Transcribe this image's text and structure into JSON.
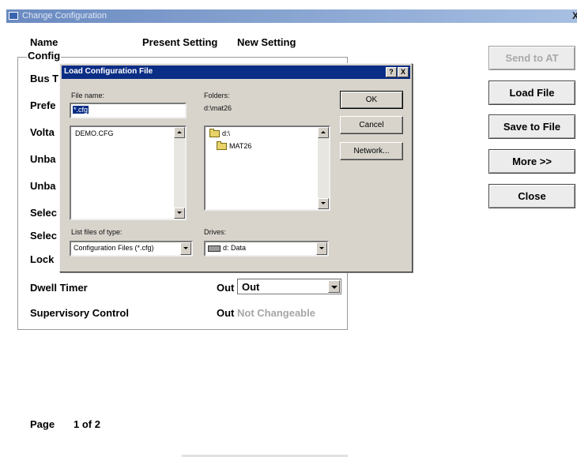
{
  "window": {
    "title": "Change Configuration",
    "close_glyph": "X"
  },
  "headers": {
    "name": "Name",
    "present": "Present Setting",
    "new": "New Setting"
  },
  "group": {
    "label": "Config"
  },
  "rows": [
    {
      "label": "Bus T"
    },
    {
      "label": "Prefe"
    },
    {
      "label": "Volta"
    },
    {
      "label": "Unba"
    },
    {
      "label": "Unba"
    },
    {
      "label": "Selec"
    },
    {
      "label": "Selec"
    },
    {
      "label": "Lock"
    },
    {
      "label": "Dwell Timer",
      "present": "Out",
      "new": "Out"
    },
    {
      "label": "Supervisory Control",
      "present": "Out",
      "new": "Not Changeable"
    }
  ],
  "side_buttons": {
    "send": "Send to AT",
    "load": "Load File",
    "save": "Save to File",
    "more": "More >>",
    "close": "Close"
  },
  "footer": {
    "page_label": "Page",
    "page_value": "1 of 2"
  },
  "dialog": {
    "title": "Load Configuration File",
    "help_glyph": "?",
    "close_glyph": "X",
    "file_name_label": "File name:",
    "file_name_value": "*.cfg",
    "files": [
      "DEMO.CFG"
    ],
    "folders_label": "Folders:",
    "folders_path": "d:\\mat26",
    "folders": [
      "d:\\",
      "MAT26"
    ],
    "type_label": "List files of type:",
    "type_value": "Configuration Files (*.cfg)",
    "drives_label": "Drives:",
    "drive_value": "d: Data",
    "ok": "OK",
    "cancel": "Cancel",
    "network": "Network..."
  }
}
